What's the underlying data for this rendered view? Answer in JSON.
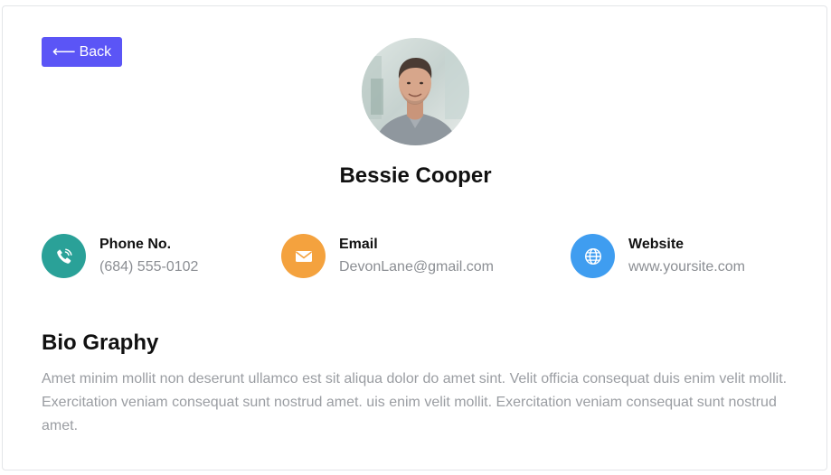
{
  "back_button": {
    "arrow": "⟵",
    "label": "Back"
  },
  "profile": {
    "name": "Bessie Cooper"
  },
  "contacts": [
    {
      "label": "Phone No.",
      "value": "(684) 555-0102",
      "icon": "phone-icon",
      "color": "#2aa198"
    },
    {
      "label": "Email",
      "value": "DevonLane@gmail.com",
      "icon": "mail-icon",
      "color": "#f4a23e"
    },
    {
      "label": "Website",
      "value": "www.yoursite.com",
      "icon": "globe-icon",
      "color": "#3f9df0"
    }
  ],
  "bio": {
    "title": "Bio Graphy",
    "text": "Amet minim mollit non deserunt ullamco est sit aliqua dolor do amet sint. Velit officia consequat duis enim velit mollit. Exercitation veniam consequat sunt nostrud amet. uis enim velit mollit. Exercitation veniam consequat sunt nostrud amet."
  },
  "colors": {
    "accent": "#5b55f6",
    "muted_text": "#9a9da2"
  }
}
